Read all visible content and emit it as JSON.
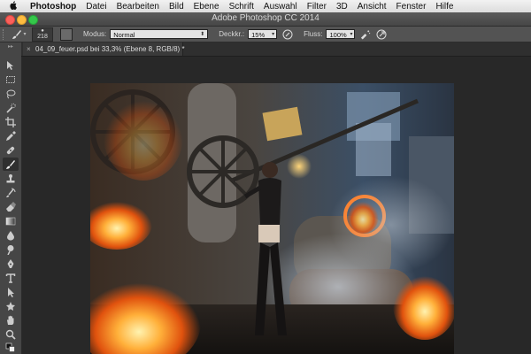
{
  "menubar": {
    "app_name": "Photoshop",
    "items": [
      "Datei",
      "Bearbeiten",
      "Bild",
      "Ebene",
      "Schrift",
      "Auswahl",
      "Filter",
      "3D",
      "Ansicht",
      "Fenster",
      "Hilfe"
    ]
  },
  "window": {
    "title": "Adobe Photoshop CC 2014"
  },
  "options": {
    "brush_size": "218",
    "mode_label": "Modus:",
    "mode_value": "Normal",
    "opacity_label": "Deckkr.:",
    "opacity_value": "15%",
    "flow_label": "Fluss:",
    "flow_value": "100%"
  },
  "document": {
    "tab_title": "04_09_feuer.psd bei 33,3% (Ebene 8, RGB/8) *"
  },
  "toolbar": {
    "tools": [
      "move-icon",
      "marquee-icon",
      "lasso-icon",
      "quick-select-icon",
      "crop-icon",
      "eyedropper-icon",
      "healing-icon",
      "brush-icon",
      "stamp-icon",
      "history-brush-icon",
      "eraser-icon",
      "gradient-icon",
      "blur-icon",
      "dodge-icon",
      "pen-icon",
      "type-icon",
      "path-select-icon",
      "shape-icon",
      "hand-icon",
      "zoom-icon"
    ],
    "active_tool": "brush-icon"
  },
  "colors": {
    "menubar": "#e6e6e6",
    "titlebar": "#4d4d4d",
    "options_bar": "#535353",
    "toolbar": "#464646",
    "workspace": "#282828"
  }
}
